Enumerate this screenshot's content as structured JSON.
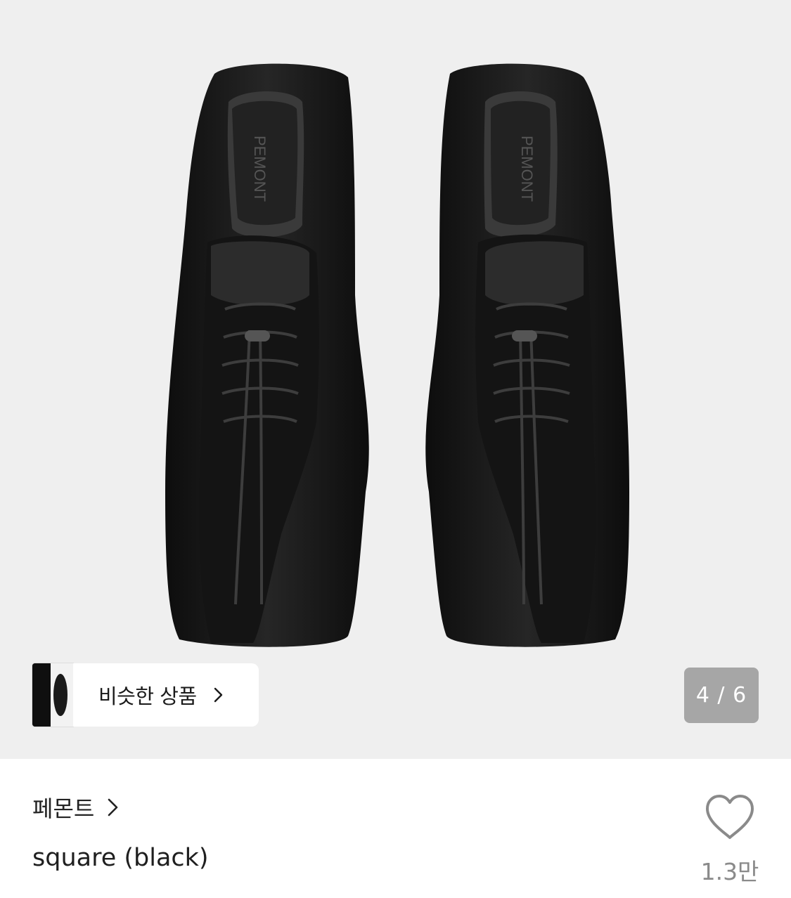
{
  "gallery": {
    "similar_label": "비슷한 상품",
    "counter": "4 / 6",
    "image": "black square-toe leather and suede sneakers, top view",
    "logo_text": "PEMONT"
  },
  "product": {
    "brand": "페몬트",
    "name": "square (black)",
    "like_count": "1.3만"
  },
  "icons": {
    "similar_chevron": "chevron-right-icon",
    "brand_chevron": "chevron-right-icon",
    "like": "heart-outline-icon"
  },
  "colors": {
    "gallery_bg": "#efefef",
    "counter_bg": "#a6a6a6",
    "text": "#222222",
    "muted": "#8a8a8a"
  }
}
